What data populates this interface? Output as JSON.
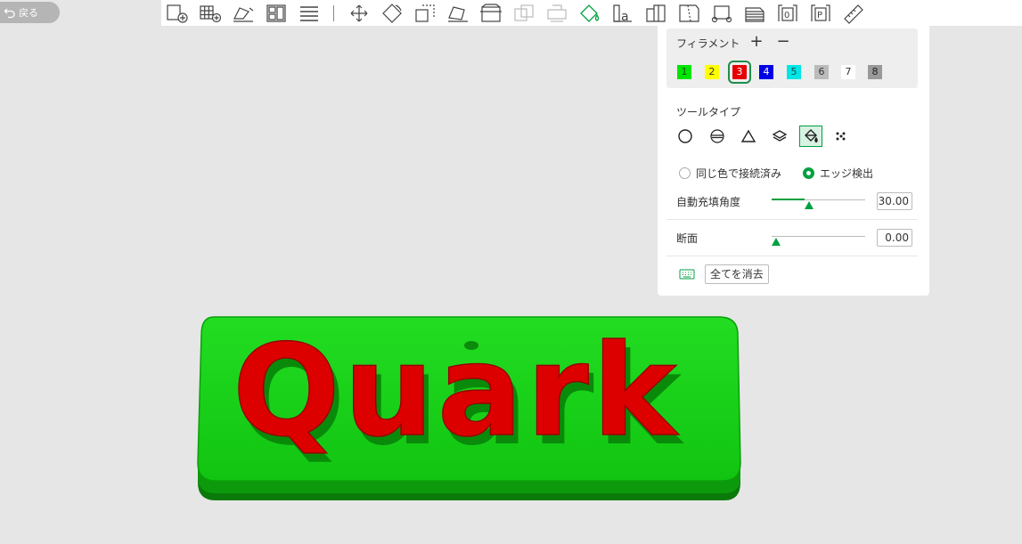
{
  "back": {
    "label": "戻る"
  },
  "toolbar": {
    "icons": [
      "add-object-icon",
      "add-grid-icon",
      "auto-orient-icon",
      "arrange-icon",
      "layers-icon",
      "move-icon",
      "rotate-icon",
      "scale-icon",
      "lay-on-face-icon",
      "cut-icon",
      "boolean-icon",
      "support-paint-icon",
      "color-paint-icon",
      "text-emboss-icon",
      "fuzzy-skin-icon",
      "seam-icon",
      "measure-clip-icon",
      "variable-layer-icon",
      "assembly-icon",
      "part-icon",
      "ruler-icon"
    ]
  },
  "panel": {
    "filament_title": "フィラメント",
    "add_label": "+",
    "remove_label": "−",
    "filaments": [
      {
        "label": "1",
        "color": "#00e600",
        "text_color": "#1a4d1a"
      },
      {
        "label": "2",
        "color": "#ffff00",
        "text_color": "#333333"
      },
      {
        "label": "3",
        "color": "#e60000",
        "text_color": "#ffffff",
        "selected": true
      },
      {
        "label": "4",
        "color": "#0000e6",
        "text_color": "#ffffff"
      },
      {
        "label": "5",
        "color": "#00e6e6",
        "text_color": "#1a4d4d"
      },
      {
        "label": "6",
        "color": "#bbbbbb",
        "text_color": "#333333"
      },
      {
        "label": "7",
        "color": "#ffffff",
        "text_color": "#333333"
      },
      {
        "label": "8",
        "color": "#999999",
        "text_color": "#222222"
      }
    ],
    "tool_type_title": "ツールタイプ",
    "tools": [
      "circle-brush-icon",
      "sphere-brush-icon",
      "triangle-icon",
      "height-range-icon",
      "fill-bucket-icon",
      "gap-fill-icon"
    ],
    "active_tool": "fill-bucket-icon",
    "radio_same_color": "同じ色で接続済み",
    "radio_edge_detect": "エッジ検出",
    "selected_radio": "edge_detect",
    "auto_fill_angle_label": "自動充填角度",
    "auto_fill_angle_value": "30.00",
    "auto_fill_angle_fraction": 0.35,
    "section_label": "断面",
    "section_value": "0.00",
    "section_fraction": 0.0,
    "clear_all_label": "全てを消去"
  },
  "model": {
    "text": "Quark",
    "base_color": "#00cc00",
    "text_color": "#dd0000"
  },
  "colors": {
    "accent": "#00a040",
    "background": "#e6e6e6"
  }
}
